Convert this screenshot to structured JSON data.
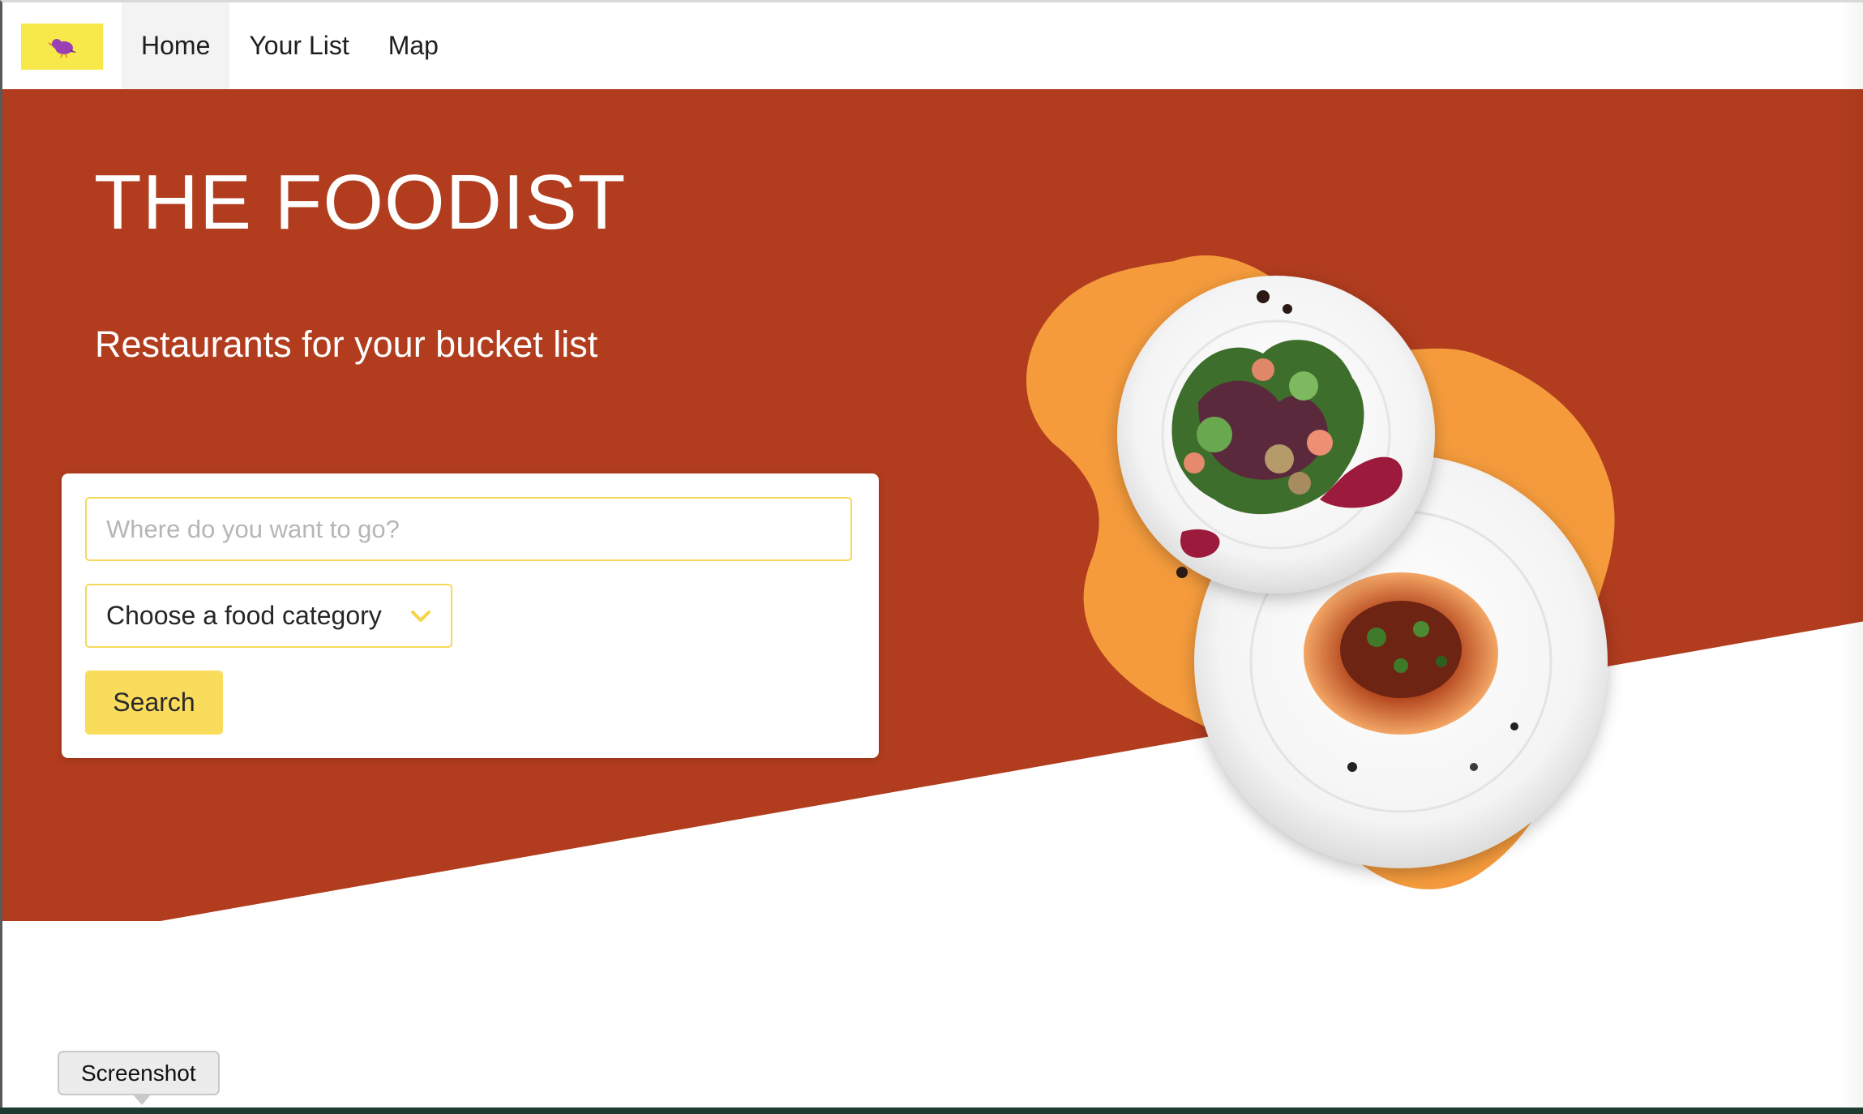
{
  "nav": {
    "logo_icon": "bird-logo-icon",
    "items": [
      {
        "label": "Home",
        "active": true
      },
      {
        "label": "Your List",
        "active": false
      },
      {
        "label": "Map",
        "active": false
      }
    ]
  },
  "hero": {
    "title": "THE FOODIST",
    "subtitle": "Restaurants for your bucket list",
    "image_icon": "food-plates-illustration"
  },
  "search": {
    "placeholder": "Where do you want to go?",
    "value": "",
    "category_label": "Choose a food category",
    "category_icon": "chevron-down-icon",
    "button_label": "Search"
  },
  "tooltip": {
    "label": "Screenshot"
  },
  "colors": {
    "hero_red": "#b13c1e",
    "accent_yellow": "#fadc5c",
    "blob_orange": "#f59b3c",
    "logo_bg": "#f8e94a",
    "logo_bird": "#9b3fb4"
  }
}
